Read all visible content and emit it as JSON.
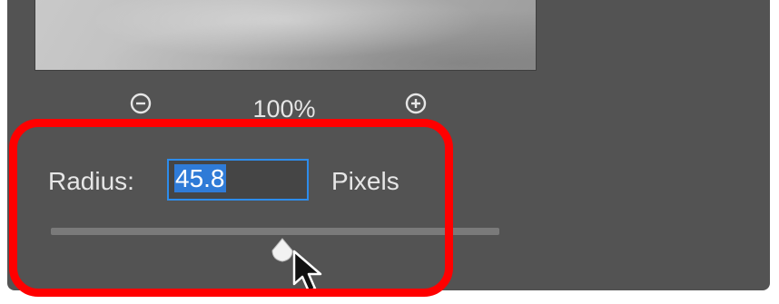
{
  "zoom": {
    "level": "100%",
    "zoom_out_icon": "zoom-out-icon",
    "zoom_in_icon": "zoom-in-icon"
  },
  "radius": {
    "label": "Radius:",
    "value": "45.8",
    "units": "Pixels"
  },
  "slider": {
    "value_fraction": 0.53
  },
  "colors": {
    "dialog_bg": "#535353",
    "highlight": "#ff0000",
    "input_focus": "#2d8ceb",
    "selection": "#2f7bd7"
  }
}
